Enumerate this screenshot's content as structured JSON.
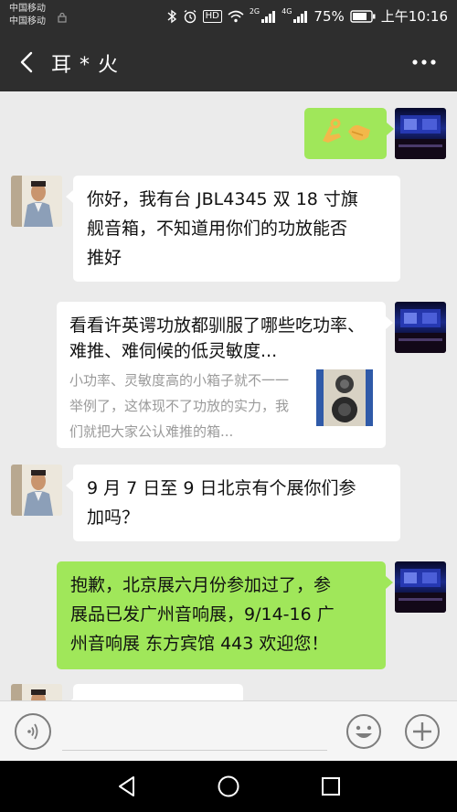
{
  "status_bar": {
    "carrier_1": "中国移动",
    "carrier_2": "中国移动",
    "hd": "HD",
    "net_1": "2G",
    "net_2": "4G",
    "battery": "75%",
    "time": "上午10:16"
  },
  "header": {
    "title": "耳 * 火",
    "back_icon": "back-arrow-icon",
    "more_icon": "more-dots-icon"
  },
  "messages": [
    {
      "side": "self",
      "type": "emoji",
      "content": "👌🤝"
    },
    {
      "side": "other",
      "type": "text",
      "lines": [
        "你好，我有台 JBL4345 双 18 寸旗",
        "舰音箱，不知道用你们的功放能否",
        "推好"
      ]
    },
    {
      "side": "self",
      "type": "card",
      "title": "看看许英谔功放都驯服了哪些吃功率、难推、难伺候的低灵敏度...",
      "desc": "小功率、灵敏度高的小箱子就不一一举例了，这体现不了功放的实力，我们就把大家公认难推的箱...",
      "thumb": "speaker-thumbnail"
    },
    {
      "side": "other",
      "type": "text",
      "lines": [
        "9 月 7 日至 9 日北京有个展你们参",
        "加吗？"
      ]
    },
    {
      "side": "self",
      "type": "text",
      "lines": [
        "抱歉，北京展六月份参加过了，参",
        "展品已发广州音响展，9/14-16 广",
        "州音响展 东方宾馆 443 欢迎您！"
      ]
    }
  ],
  "input_bar": {
    "voice_icon": "voice-input-icon",
    "emoji_icon": "emoji-icon",
    "plus_icon": "plus-icon"
  },
  "colors": {
    "bar_dark": "#2e2e2e",
    "chat_bg": "#ebebeb",
    "bubble_green": "#a0e75a",
    "bubble_white": "#ffffff"
  }
}
